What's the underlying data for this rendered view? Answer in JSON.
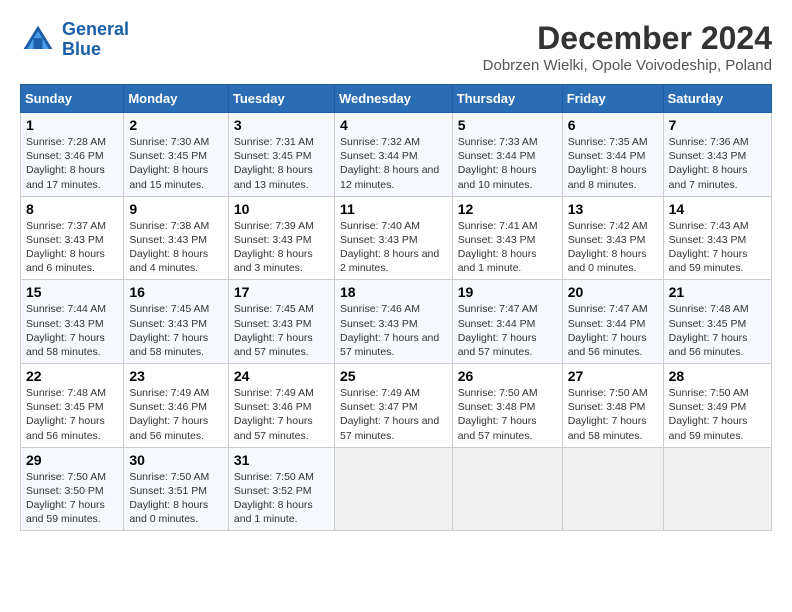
{
  "header": {
    "logo_line1": "General",
    "logo_line2": "Blue",
    "title": "December 2024",
    "subtitle": "Dobrzen Wielki, Opole Voivodeship, Poland"
  },
  "weekdays": [
    "Sunday",
    "Monday",
    "Tuesday",
    "Wednesday",
    "Thursday",
    "Friday",
    "Saturday"
  ],
  "weeks": [
    [
      {
        "day": "1",
        "sunrise": "Sunrise: 7:28 AM",
        "sunset": "Sunset: 3:46 PM",
        "daylight": "Daylight: 8 hours and 17 minutes."
      },
      {
        "day": "2",
        "sunrise": "Sunrise: 7:30 AM",
        "sunset": "Sunset: 3:45 PM",
        "daylight": "Daylight: 8 hours and 15 minutes."
      },
      {
        "day": "3",
        "sunrise": "Sunrise: 7:31 AM",
        "sunset": "Sunset: 3:45 PM",
        "daylight": "Daylight: 8 hours and 13 minutes."
      },
      {
        "day": "4",
        "sunrise": "Sunrise: 7:32 AM",
        "sunset": "Sunset: 3:44 PM",
        "daylight": "Daylight: 8 hours and 12 minutes."
      },
      {
        "day": "5",
        "sunrise": "Sunrise: 7:33 AM",
        "sunset": "Sunset: 3:44 PM",
        "daylight": "Daylight: 8 hours and 10 minutes."
      },
      {
        "day": "6",
        "sunrise": "Sunrise: 7:35 AM",
        "sunset": "Sunset: 3:44 PM",
        "daylight": "Daylight: 8 hours and 8 minutes."
      },
      {
        "day": "7",
        "sunrise": "Sunrise: 7:36 AM",
        "sunset": "Sunset: 3:43 PM",
        "daylight": "Daylight: 8 hours and 7 minutes."
      }
    ],
    [
      {
        "day": "8",
        "sunrise": "Sunrise: 7:37 AM",
        "sunset": "Sunset: 3:43 PM",
        "daylight": "Daylight: 8 hours and 6 minutes."
      },
      {
        "day": "9",
        "sunrise": "Sunrise: 7:38 AM",
        "sunset": "Sunset: 3:43 PM",
        "daylight": "Daylight: 8 hours and 4 minutes."
      },
      {
        "day": "10",
        "sunrise": "Sunrise: 7:39 AM",
        "sunset": "Sunset: 3:43 PM",
        "daylight": "Daylight: 8 hours and 3 minutes."
      },
      {
        "day": "11",
        "sunrise": "Sunrise: 7:40 AM",
        "sunset": "Sunset: 3:43 PM",
        "daylight": "Daylight: 8 hours and 2 minutes."
      },
      {
        "day": "12",
        "sunrise": "Sunrise: 7:41 AM",
        "sunset": "Sunset: 3:43 PM",
        "daylight": "Daylight: 8 hours and 1 minute."
      },
      {
        "day": "13",
        "sunrise": "Sunrise: 7:42 AM",
        "sunset": "Sunset: 3:43 PM",
        "daylight": "Daylight: 8 hours and 0 minutes."
      },
      {
        "day": "14",
        "sunrise": "Sunrise: 7:43 AM",
        "sunset": "Sunset: 3:43 PM",
        "daylight": "Daylight: 7 hours and 59 minutes."
      }
    ],
    [
      {
        "day": "15",
        "sunrise": "Sunrise: 7:44 AM",
        "sunset": "Sunset: 3:43 PM",
        "daylight": "Daylight: 7 hours and 58 minutes."
      },
      {
        "day": "16",
        "sunrise": "Sunrise: 7:45 AM",
        "sunset": "Sunset: 3:43 PM",
        "daylight": "Daylight: 7 hours and 58 minutes."
      },
      {
        "day": "17",
        "sunrise": "Sunrise: 7:45 AM",
        "sunset": "Sunset: 3:43 PM",
        "daylight": "Daylight: 7 hours and 57 minutes."
      },
      {
        "day": "18",
        "sunrise": "Sunrise: 7:46 AM",
        "sunset": "Sunset: 3:43 PM",
        "daylight": "Daylight: 7 hours and 57 minutes."
      },
      {
        "day": "19",
        "sunrise": "Sunrise: 7:47 AM",
        "sunset": "Sunset: 3:44 PM",
        "daylight": "Daylight: 7 hours and 57 minutes."
      },
      {
        "day": "20",
        "sunrise": "Sunrise: 7:47 AM",
        "sunset": "Sunset: 3:44 PM",
        "daylight": "Daylight: 7 hours and 56 minutes."
      },
      {
        "day": "21",
        "sunrise": "Sunrise: 7:48 AM",
        "sunset": "Sunset: 3:45 PM",
        "daylight": "Daylight: 7 hours and 56 minutes."
      }
    ],
    [
      {
        "day": "22",
        "sunrise": "Sunrise: 7:48 AM",
        "sunset": "Sunset: 3:45 PM",
        "daylight": "Daylight: 7 hours and 56 minutes."
      },
      {
        "day": "23",
        "sunrise": "Sunrise: 7:49 AM",
        "sunset": "Sunset: 3:46 PM",
        "daylight": "Daylight: 7 hours and 56 minutes."
      },
      {
        "day": "24",
        "sunrise": "Sunrise: 7:49 AM",
        "sunset": "Sunset: 3:46 PM",
        "daylight": "Daylight: 7 hours and 57 minutes."
      },
      {
        "day": "25",
        "sunrise": "Sunrise: 7:49 AM",
        "sunset": "Sunset: 3:47 PM",
        "daylight": "Daylight: 7 hours and 57 minutes."
      },
      {
        "day": "26",
        "sunrise": "Sunrise: 7:50 AM",
        "sunset": "Sunset: 3:48 PM",
        "daylight": "Daylight: 7 hours and 57 minutes."
      },
      {
        "day": "27",
        "sunrise": "Sunrise: 7:50 AM",
        "sunset": "Sunset: 3:48 PM",
        "daylight": "Daylight: 7 hours and 58 minutes."
      },
      {
        "day": "28",
        "sunrise": "Sunrise: 7:50 AM",
        "sunset": "Sunset: 3:49 PM",
        "daylight": "Daylight: 7 hours and 59 minutes."
      }
    ],
    [
      {
        "day": "29",
        "sunrise": "Sunrise: 7:50 AM",
        "sunset": "Sunset: 3:50 PM",
        "daylight": "Daylight: 7 hours and 59 minutes."
      },
      {
        "day": "30",
        "sunrise": "Sunrise: 7:50 AM",
        "sunset": "Sunset: 3:51 PM",
        "daylight": "Daylight: 8 hours and 0 minutes."
      },
      {
        "day": "31",
        "sunrise": "Sunrise: 7:50 AM",
        "sunset": "Sunset: 3:52 PM",
        "daylight": "Daylight: 8 hours and 1 minute."
      },
      null,
      null,
      null,
      null
    ]
  ]
}
